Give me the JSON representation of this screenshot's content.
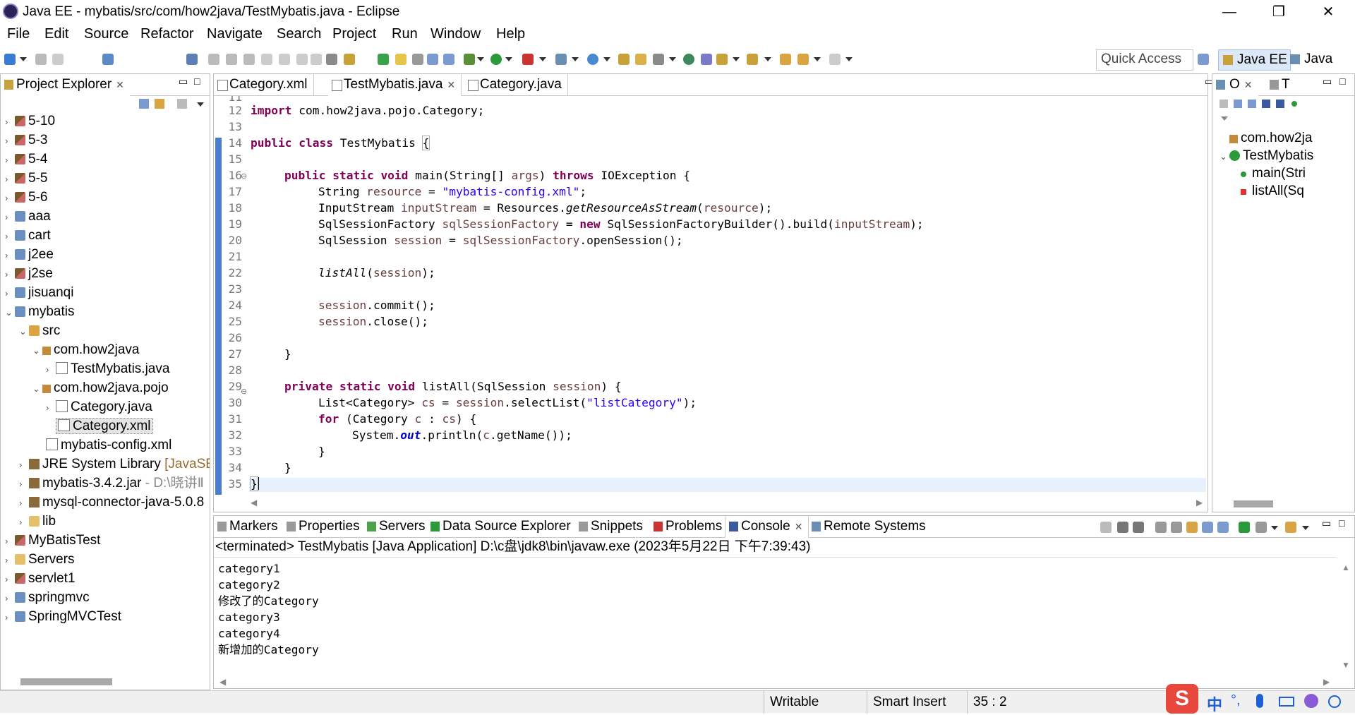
{
  "window": {
    "title": "Java EE - mybatis/src/com/how2java/TestMybatis.java - Eclipse",
    "minimize": "—",
    "maximize": "❐",
    "close": "✕"
  },
  "menu": [
    "File",
    "Edit",
    "Source",
    "Refactor",
    "Navigate",
    "Search",
    "Project",
    "Run",
    "Window",
    "Help"
  ],
  "toolbar": {
    "quick_access": "Quick Access",
    "perspectives": [
      "Java EE",
      "Java"
    ]
  },
  "project_explorer": {
    "title": "Project Explorer",
    "items": [
      {
        "label": "5-10"
      },
      {
        "label": "5-3"
      },
      {
        "label": "5-4"
      },
      {
        "label": "5-5"
      },
      {
        "label": "5-6"
      },
      {
        "label": "aaa"
      },
      {
        "label": "cart"
      },
      {
        "label": "j2ee"
      },
      {
        "label": "j2se"
      },
      {
        "label": "jisuanqi"
      },
      {
        "label": "mybatis"
      },
      {
        "label": "src"
      },
      {
        "label": "com.how2java"
      },
      {
        "label": "TestMybatis.java"
      },
      {
        "label": "com.how2java.pojo"
      },
      {
        "label": "Category.java"
      },
      {
        "label": "Category.xml"
      },
      {
        "label": "mybatis-config.xml"
      },
      {
        "label": "JRE System Library",
        "suffix": "[JavaSE"
      },
      {
        "label": "mybatis-3.4.2.jar",
        "suffix": "- D:\\晓讲Ⅱ"
      },
      {
        "label": "mysql-connector-java-5.0.8"
      },
      {
        "label": "lib"
      },
      {
        "label": "MyBatisTest"
      },
      {
        "label": "Servers"
      },
      {
        "label": "servlet1"
      },
      {
        "label": "springmvc"
      },
      {
        "label": "SpringMVCTest"
      }
    ]
  },
  "editor": {
    "tabs": [
      {
        "label": "Category.xml"
      },
      {
        "label": "TestMybatis.java",
        "close": "✕"
      },
      {
        "label": "Category.java"
      }
    ],
    "line_numbers": [
      "11",
      "12",
      "13",
      "14",
      "15",
      "16",
      "17",
      "18",
      "19",
      "20",
      "21",
      "22",
      "23",
      "24",
      "25",
      "26",
      "27",
      "28",
      "29",
      "30",
      "31",
      "32",
      "33",
      "34",
      "35"
    ],
    "code": {
      "l12_kw": "import",
      "l12_rest": " com.how2java.pojo.Category;",
      "l14_kw": "public class",
      "l14_rest": " TestMybatis ",
      "l14_brace": "{",
      "l16_kw": "public static void",
      "l16_a": " main(String[] ",
      "l16_args": "args",
      "l16_b": ") ",
      "l16_throws": "throws",
      "l16_c": " IOException {",
      "l17_a": "String ",
      "l17_var": "resource",
      "l17_b": " = ",
      "l17_str": "\"mybatis-config.xml\"",
      "l17_c": ";",
      "l18_a": "InputStream ",
      "l18_var": "inputStream",
      "l18_b": " = Resources.",
      "l18_m": "getResourceAsStream",
      "l18_c": "(",
      "l18_arg": "resource",
      "l18_d": ");",
      "l19_a": "SqlSessionFactory ",
      "l19_var": "sqlSessionFactory",
      "l19_b": " = ",
      "l19_new": "new",
      "l19_c": " SqlSessionFactoryBuilder().build(",
      "l19_arg": "inputStream",
      "l19_d": ");",
      "l20_a": "SqlSession ",
      "l20_var": "session",
      "l20_b": " = ",
      "l20_var2": "sqlSessionFactory",
      "l20_c": ".openSession();",
      "l22_m": "listAll",
      "l22_a": "(",
      "l22_arg": "session",
      "l22_b": ");",
      "l24_var": "session",
      "l24_a": ".commit();",
      "l25_var": "session",
      "l25_a": ".close();",
      "l27": "}",
      "l29_kw": "private static void",
      "l29_a": " listAll(SqlSession ",
      "l29_arg": "session",
      "l29_b": ") {",
      "l30_a": "List<Category> ",
      "l30_var": "cs",
      "l30_b": " = ",
      "l30_var2": "session",
      "l30_c": ".selectList(",
      "l30_str": "\"listCategory\"",
      "l30_d": ");",
      "l31_kw": "for",
      "l31_a": " (Category ",
      "l31_var": "c",
      "l31_b": " : ",
      "l31_var2": "cs",
      "l31_c": ") {",
      "l32_a": "System.",
      "l32_out": "out",
      "l32_b": ".println(",
      "l32_var": "c",
      "l32_c": ".getName());",
      "l33": "}",
      "l34": "}",
      "l35": "}"
    }
  },
  "outline": {
    "tabs": [
      "O",
      "T"
    ],
    "items": [
      {
        "label": "com.how2ja"
      },
      {
        "label": "TestMybatis"
      },
      {
        "label": "main(Stri"
      },
      {
        "label": "listAll(Sq"
      }
    ]
  },
  "bottom_panel": {
    "tabs": [
      "Markers",
      "Properties",
      "Servers",
      "Data Source Explorer",
      "Snippets",
      "Problems",
      "Console",
      "Remote Systems"
    ],
    "console_close": "✕",
    "console_header": "<terminated> TestMybatis [Java Application] D:\\c盘\\jdk8\\bin\\javaw.exe (2023年5月22日 下午7:39:43)",
    "console_lines": [
      "category1",
      "category2",
      "修改了的Category",
      "category3",
      "category4",
      "新增加的Category"
    ]
  },
  "statusbar": {
    "writable": "Writable",
    "insert_mode": "Smart Insert",
    "position": "35 : 2"
  },
  "ime": {
    "logo": "S",
    "lang": "中",
    "punct": "°,"
  },
  "colors": {
    "keyword": "#7f0055",
    "string": "#2a00ff",
    "field": "#6a3e3e",
    "static_field": "#0000c0",
    "selection_bar": "#4a7ccf"
  }
}
